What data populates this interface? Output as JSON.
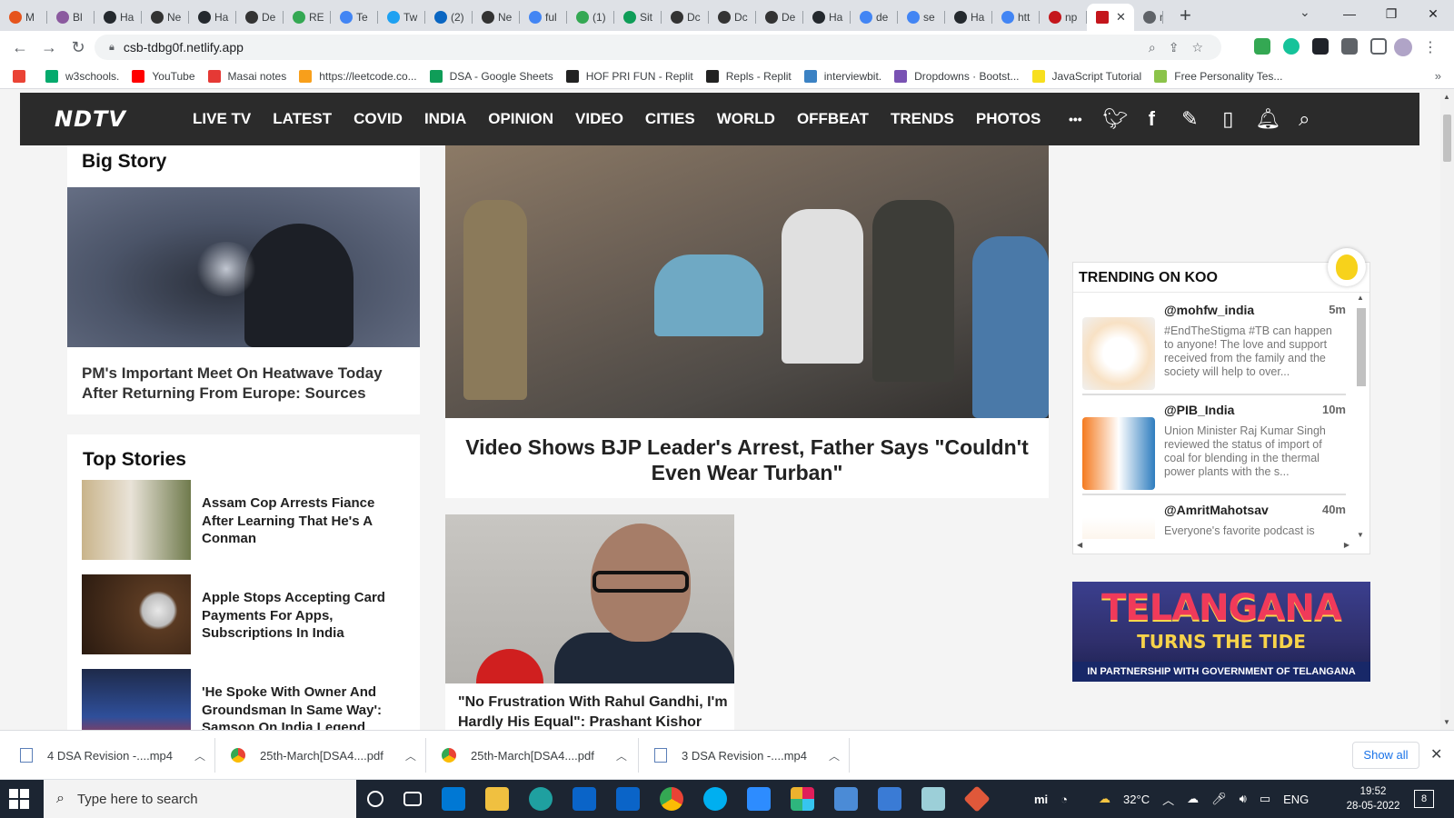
{
  "browser": {
    "tabs": [
      {
        "label": "M"
      },
      {
        "label": "Bl"
      },
      {
        "label": "Ha"
      },
      {
        "label": "Ne"
      },
      {
        "label": "Ha"
      },
      {
        "label": "De"
      },
      {
        "label": "RE"
      },
      {
        "label": "Te"
      },
      {
        "label": "Tw"
      },
      {
        "label": "(2)"
      },
      {
        "label": "Ne"
      },
      {
        "label": "ful"
      },
      {
        "label": "(1)"
      },
      {
        "label": "Sit"
      },
      {
        "label": "Dc"
      },
      {
        "label": "Dc"
      },
      {
        "label": "De"
      },
      {
        "label": "Ha"
      },
      {
        "label": "de"
      },
      {
        "label": "se"
      },
      {
        "label": "Ha"
      },
      {
        "label": "htt"
      },
      {
        "label": "np"
      }
    ],
    "active_tab": {
      "label": "",
      "close": "✕"
    },
    "after_tab": {
      "label": "nc"
    },
    "new_tab_glyph": "+",
    "url": "csb-tdbg0f.netlify.app",
    "window_controls": {
      "minimize": "—",
      "maximize": "❐",
      "close": "✕"
    }
  },
  "bookmarks": [
    {
      "label": "",
      "color": "#ea4335"
    },
    {
      "label": "w3schools.",
      "color": "#04aa6d"
    },
    {
      "label": "YouTube",
      "color": "#ff0000"
    },
    {
      "label": "Masai notes",
      "color": "#e53935"
    },
    {
      "label": "https://leetcode.co...",
      "color": "#f89f1b"
    },
    {
      "label": "DSA - Google Sheets",
      "color": "#0f9d58"
    },
    {
      "label": "HOF PRI FUN - Replit",
      "color": "#222222"
    },
    {
      "label": "Repls - Replit",
      "color": "#222222"
    },
    {
      "label": "interviewbit.",
      "color": "#3b82c4"
    },
    {
      "label": "Dropdowns · Bootst...",
      "color": "#7952b3"
    },
    {
      "label": "JavaScript Tutorial",
      "color": "#f7df1e"
    },
    {
      "label": "Free Personality Tes...",
      "color": "#8bc34a"
    }
  ],
  "ndtv": {
    "logo": "NDTV",
    "nav": [
      "LIVE TV",
      "LATEST",
      "COVID",
      "INDIA",
      "OPINION",
      "VIDEO",
      "CITIES",
      "WORLD",
      "OFFBEAT",
      "TRENDS",
      "PHOTOS"
    ],
    "more_glyph": "•••"
  },
  "big_story": {
    "title": "Big Story",
    "headline": "PM's Important Meet On Heatwave Today After Returning From Europe: Sources"
  },
  "top_stories": {
    "title": "Top Stories",
    "items": [
      {
        "text": "Assam Cop Arrests Fiance After Learning That He's A Conman"
      },
      {
        "text": "Apple Stops Accepting Card Payments For Apps, Subscriptions In India"
      },
      {
        "text": "'He Spoke With Owner And Groundsman In Same Way': Samson On India Legend"
      }
    ]
  },
  "main_story": {
    "headline": "Video Shows BJP Leader's Arrest, Father Says \"Couldn't Even Wear Turban\""
  },
  "sub_story": {
    "headline": "\"No Frustration With Rahul Gandhi, I'm Hardly His Equal\": Prashant Kishor"
  },
  "koo": {
    "title": "TRENDING ON KOO",
    "items": [
      {
        "handle": "@mohfw_india",
        "time": "5m",
        "text": "#EndTheStigma #TB can happen to anyone! The love and support received from the family and the society will help to over..."
      },
      {
        "handle": "@PIB_India",
        "time": "10m",
        "text": "Union Minister Raj Kumar Singh reviewed the status of import of coal for blending in the thermal power plants with the s..."
      },
      {
        "handle": "@AmritMahotsav",
        "time": "40m",
        "text": "Everyone's favorite podcast is"
      }
    ]
  },
  "ad": {
    "title": "TELANGANA",
    "subtitle": "TURNS THE TIDE",
    "partner": "IN PARTNERSHIP WITH GOVERNMENT OF TELANGANA"
  },
  "downloads": {
    "items": [
      {
        "name": "4 DSA Revision -....mp4"
      },
      {
        "name": "25th-March[DSA4....pdf"
      },
      {
        "name": "25th-March[DSA4....pdf"
      },
      {
        "name": "3 DSA Revision -....mp4"
      }
    ],
    "show_all": "Show all"
  },
  "taskbar": {
    "search_placeholder": "Type here to search",
    "temperature": "32°C",
    "language": "ENG",
    "time": "19:52",
    "date": "28-05-2022",
    "notifications": "8"
  }
}
